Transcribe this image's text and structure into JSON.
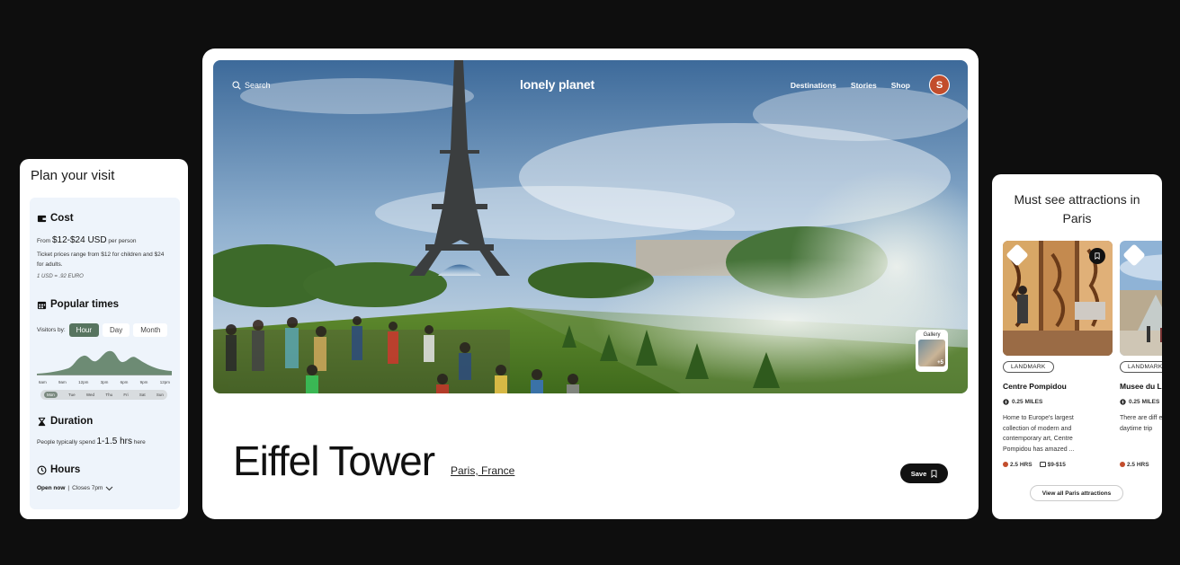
{
  "plan": {
    "title": "Plan your visit",
    "cost": {
      "heading": "Cost",
      "from_label": "From",
      "price_range": "$12-$24 USD",
      "per_person": "per person",
      "note": "Ticket prices range from $12 for children and $24 for adults.",
      "exchange": "1 USD = .92 EURO"
    },
    "popular": {
      "heading": "Popular times",
      "visitors_by": "Visitors by:",
      "tabs": [
        "Hour",
        "Day",
        "Month"
      ],
      "active_tab": "Hour",
      "hour_labels": [
        "6am",
        "9am",
        "12pm",
        "3pm",
        "6pm",
        "9pm",
        "12pm"
      ],
      "days": [
        "Mon",
        "Tue",
        "Wed",
        "Thu",
        "Fri",
        "Sat",
        "Sun"
      ],
      "active_day": "Mon"
    },
    "duration": {
      "heading": "Duration",
      "prefix": "People typically spend",
      "value": "1-1.5 hrs",
      "suffix": "here"
    },
    "hours": {
      "heading": "Hours",
      "status": "Open now",
      "closes": "Closes 7pm"
    }
  },
  "nav": {
    "search": "Search",
    "logo": "lonely planet",
    "links": [
      "Destinations",
      "Stories",
      "Shop"
    ],
    "avatar_initial": "S"
  },
  "hero": {
    "gallery_label": "Gallery",
    "gallery_count": "+5"
  },
  "place": {
    "title": "Eiffel Tower",
    "location": "Paris, France",
    "save_label": "Save"
  },
  "attractions": {
    "title": "Must see attractions in Paris",
    "view_all": "View all Paris attractions",
    "items": [
      {
        "badge": "LANDMARK",
        "name": "Centre Pompidou",
        "distance": "0.25 MILES",
        "description": "Home to Europe's largest collection of modern and contemporary art, Centre Pompidou has amazed ...",
        "duration": "2.5 HRS",
        "price": "$9-$15"
      },
      {
        "badge": "LANDMARK",
        "name": "Musee du L",
        "distance": "0.25 MILES",
        "description": "There are diff experience th a daytime trip",
        "duration": "2.5 HRS"
      }
    ]
  },
  "colors": {
    "accent": "#c24d2c",
    "active_tab": "#57745f",
    "panel_bg": "#eef4fb"
  }
}
